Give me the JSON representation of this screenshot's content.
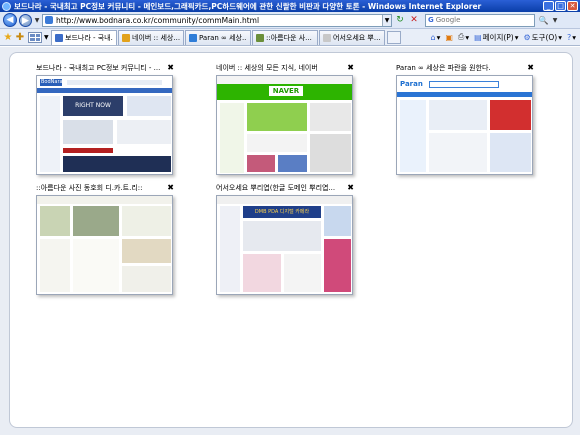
{
  "window": {
    "title": "보드나라 - 국내최고 PC정보 커뮤니티 - 메인보드,그래픽카드,PC하드웨어에 관한 신랄한 비판과 다양한 토론 - Windows Internet Explorer",
    "minimize": "_",
    "maximize": "□",
    "close": "✕"
  },
  "address": {
    "url": "http://www.bodnara.co.kr/community/commMain.html",
    "search_placeholder": "Google",
    "search_engine_label": "G"
  },
  "tabs": [
    {
      "label": "보드나라 - 국내...",
      "active": true,
      "color": "#3b6cc8"
    },
    {
      "label": "네이버 :: 세상...",
      "active": false,
      "color": "#e2a21c"
    },
    {
      "label": "Paran ∞ 세상...",
      "active": false,
      "color": "#2f7dd8"
    },
    {
      "label": "::아름다운 사...",
      "active": false,
      "color": "#6b8f3a"
    },
    {
      "label": "어서오세요 뿌...",
      "active": false,
      "color": "#c8c8c8"
    }
  ],
  "commands": {
    "page": "페이지(P)",
    "tools": "도구(O)"
  },
  "thumbnails": [
    {
      "title": "보드나라 - 국내최고 PC정보 커뮤니티 - ...",
      "close": "✖"
    },
    {
      "title": "네이버 :: 세상의 모든 지식, 네이버",
      "close": "✖"
    },
    {
      "title": "Paran ∞ 세상은 파란을 원한다.",
      "close": "✖"
    },
    {
      "title": "::아름다운 사진 동호회 디.카.트.리::",
      "close": "✖"
    },
    {
      "title": "어서오세요 뿌리엽(한글 도메인 뿌리엽...",
      "close": "✖"
    }
  ],
  "thumb_content": {
    "bodnara_logo": "BodNara",
    "bodnara_banner": "RIGHT NOW",
    "naver_logo": "NAVER",
    "paran_logo": "Paran",
    "pda_banner": "DMB PDA 디지털 카메라"
  },
  "colors": {
    "titlebar": "#0a3ea8",
    "accent": "#3b6cc8"
  }
}
